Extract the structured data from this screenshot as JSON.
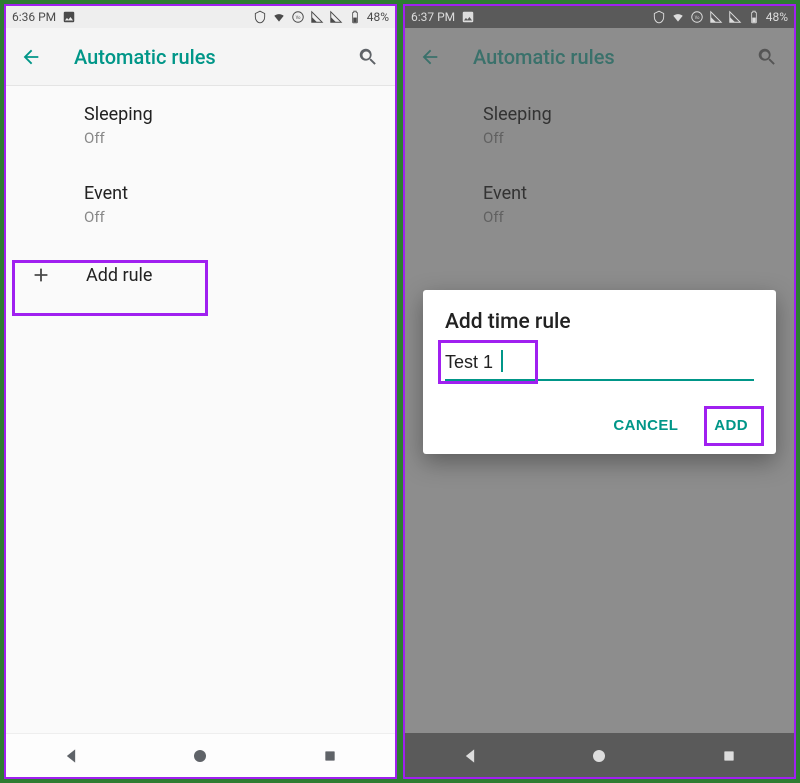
{
  "accent": "#009688",
  "highlight": "#a020f0",
  "left": {
    "statusbar": {
      "time": "6:36 PM",
      "battery": "48%"
    },
    "appbar": {
      "title": "Automatic rules"
    },
    "rules": [
      {
        "title": "Sleeping",
        "status": "Off"
      },
      {
        "title": "Event",
        "status": "Off"
      }
    ],
    "add_rule_label": "Add rule"
  },
  "right": {
    "statusbar": {
      "time": "6:37 PM",
      "battery": "48%"
    },
    "appbar": {
      "title": "Automatic rules"
    },
    "rules": [
      {
        "title": "Sleeping",
        "status": "Off"
      },
      {
        "title": "Event",
        "status": "Off"
      }
    ],
    "dialog": {
      "title": "Add time rule",
      "input_value": "Test 1",
      "cancel": "CANCEL",
      "add": "ADD"
    }
  }
}
